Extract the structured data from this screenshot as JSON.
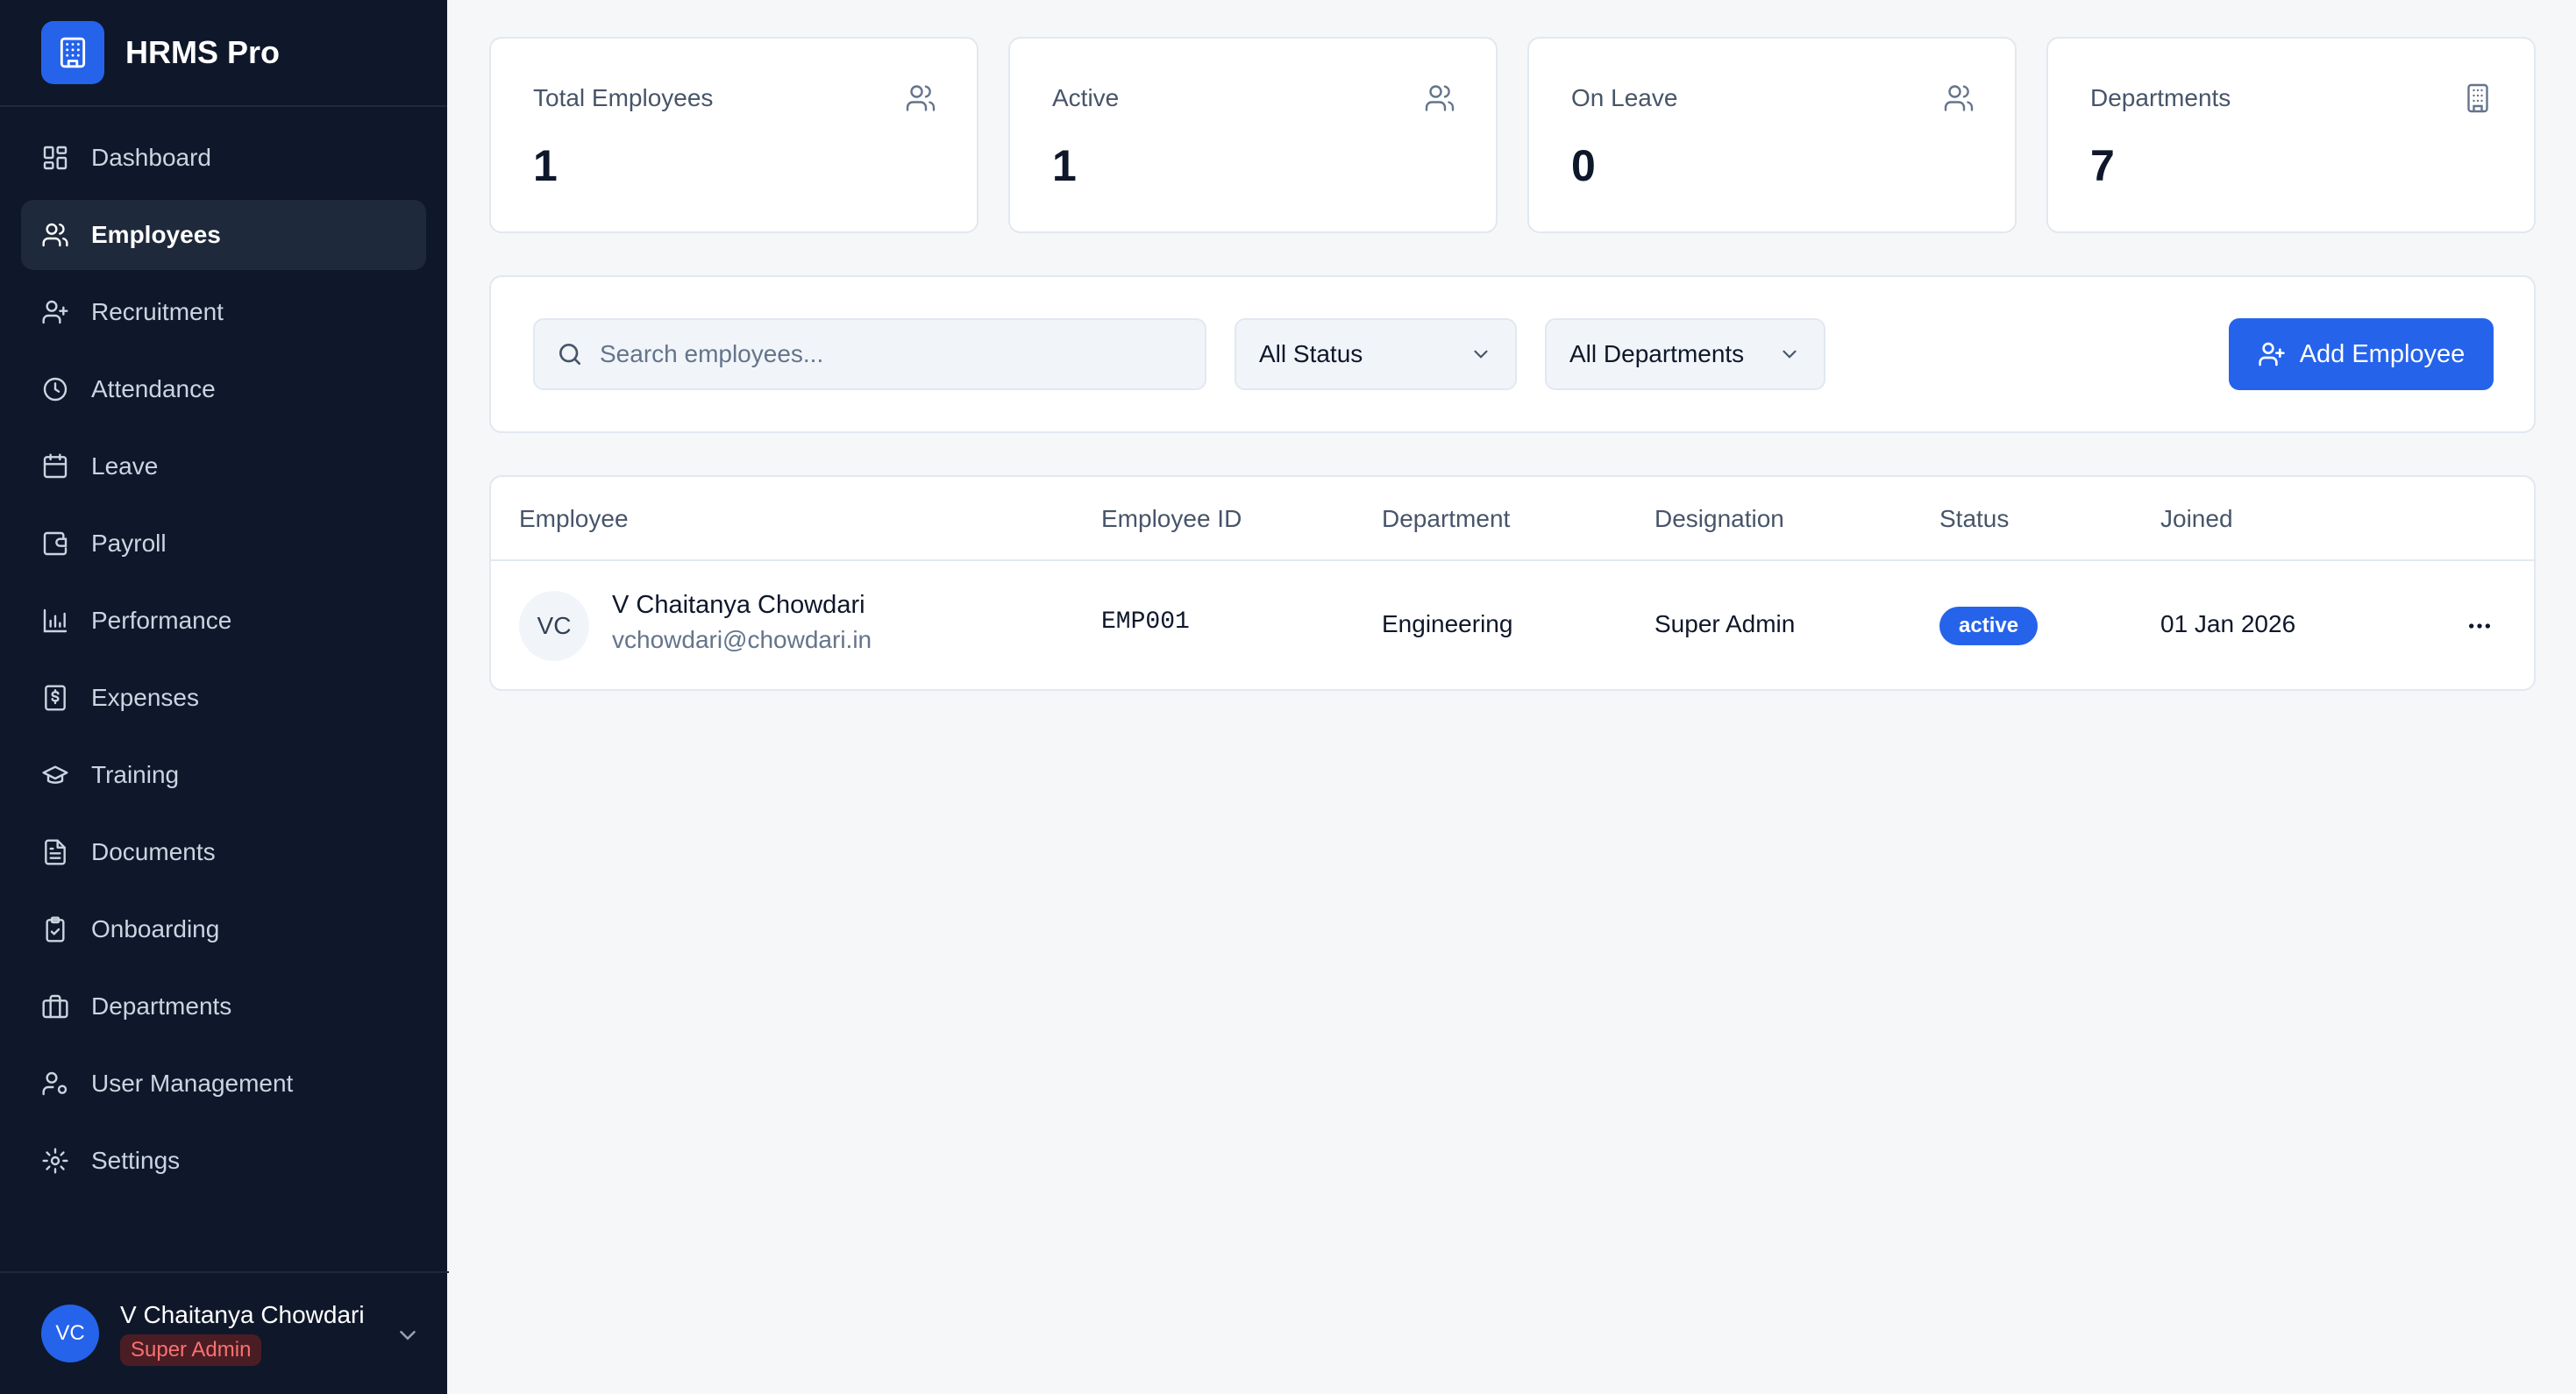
{
  "brand": {
    "name": "HRMS Pro",
    "icon": "building-icon",
    "color": "#2563eb"
  },
  "sidebar": {
    "items": [
      {
        "label": "Dashboard",
        "icon": "dashboard-icon",
        "active": false
      },
      {
        "label": "Employees",
        "icon": "users-icon",
        "active": true
      },
      {
        "label": "Recruitment",
        "icon": "user-plus-icon",
        "active": false
      },
      {
        "label": "Attendance",
        "icon": "clock-icon",
        "active": false
      },
      {
        "label": "Leave",
        "icon": "calendar-icon",
        "active": false
      },
      {
        "label": "Payroll",
        "icon": "wallet-icon",
        "active": false
      },
      {
        "label": "Performance",
        "icon": "bar-chart-icon",
        "active": false
      },
      {
        "label": "Expenses",
        "icon": "receipt-icon",
        "active": false
      },
      {
        "label": "Training",
        "icon": "graduation-cap-icon",
        "active": false
      },
      {
        "label": "Documents",
        "icon": "file-text-icon",
        "active": false
      },
      {
        "label": "Onboarding",
        "icon": "clipboard-check-icon",
        "active": false
      },
      {
        "label": "Departments",
        "icon": "briefcase-icon",
        "active": false
      },
      {
        "label": "User Management",
        "icon": "user-cog-icon",
        "active": false
      },
      {
        "label": "Settings",
        "icon": "gear-icon",
        "active": false
      }
    ]
  },
  "user": {
    "initials": "VC",
    "name": "V Chaitanya Chowdari",
    "role": "Super Admin"
  },
  "stats": [
    {
      "title": "Total Employees",
      "value": "1",
      "icon": "users-icon"
    },
    {
      "title": "Active",
      "value": "1",
      "icon": "users-icon"
    },
    {
      "title": "On Leave",
      "value": "0",
      "icon": "users-icon"
    },
    {
      "title": "Departments",
      "value": "7",
      "icon": "building-icon"
    }
  ],
  "filters": {
    "search_placeholder": "Search employees...",
    "status_selected": "All Status",
    "department_selected": "All Departments",
    "add_button": "Add Employee"
  },
  "table": {
    "headers": [
      "Employee",
      "Employee ID",
      "Department",
      "Designation",
      "Status",
      "Joined"
    ],
    "rows": [
      {
        "initials": "VC",
        "name": "V Chaitanya Chowdari",
        "email": "vchowdari@chowdari.in",
        "employee_id": "EMP001",
        "department": "Engineering",
        "designation": "Super Admin",
        "status": "active",
        "joined": "01 Jan 2026"
      }
    ]
  },
  "colors": {
    "sidebar_bg": "#0f172a",
    "accent": "#2563eb",
    "page_bg": "#f6f7f9",
    "role_text": "#f87171"
  }
}
